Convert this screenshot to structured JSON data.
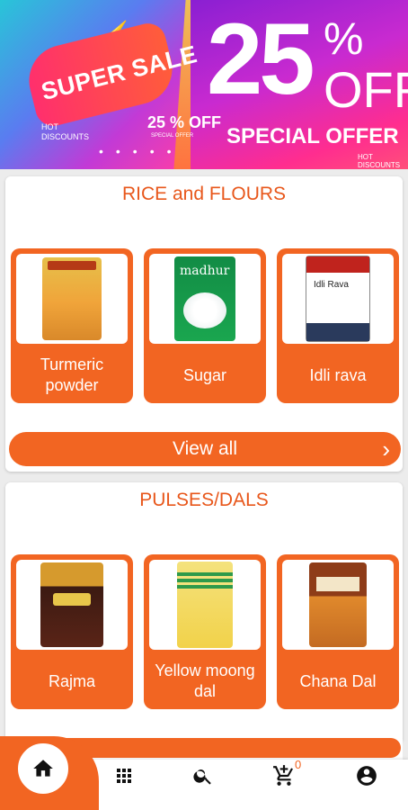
{
  "banner": {
    "left_text": "SUPER SALE",
    "hot_discounts": "HOT DISCOUNTS",
    "mini_off": "25 % OFF",
    "mini_special": "SPECIAL OFFER",
    "big_number": "25",
    "big_pct": "%",
    "big_off": "OFF",
    "special_offer": "SPECIAL OFFER",
    "hot_discounts_right": "HOT DISCOUNTS"
  },
  "sections": [
    {
      "title": "RICE and FLOURS",
      "products": [
        {
          "name": "Turmeric powder"
        },
        {
          "name": "Sugar",
          "brand": "madhur"
        },
        {
          "name": "Idli rava",
          "brand": "Idli Rava"
        }
      ],
      "view_all_label": "View all"
    },
    {
      "title": "PULSES/DALS",
      "products": [
        {
          "name": "Rajma"
        },
        {
          "name": "Yellow moong dal"
        },
        {
          "name": "Chana Dal"
        }
      ]
    }
  ],
  "bottom_nav": {
    "cart_count": "0"
  },
  "colors": {
    "accent": "#f26522",
    "title": "#e8571b"
  }
}
